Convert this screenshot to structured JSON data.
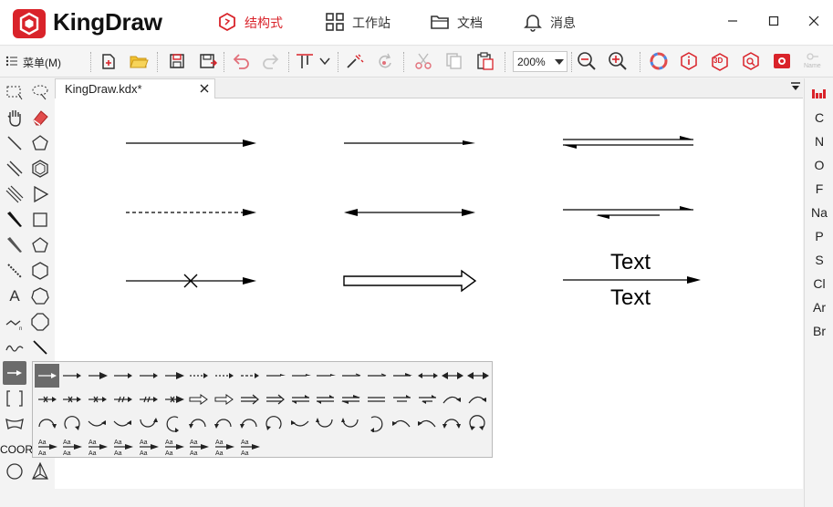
{
  "app": {
    "name": "KingDraw",
    "brand_color": "#d9232a"
  },
  "nav": {
    "tabs": [
      {
        "label": "结构式",
        "icon": "structure-icon",
        "active": true
      },
      {
        "label": "工作站",
        "icon": "workstation-icon",
        "active": false
      },
      {
        "label": "文档",
        "icon": "folder-icon",
        "active": false
      },
      {
        "label": "消息",
        "icon": "bell-icon",
        "active": false
      }
    ]
  },
  "window_controls": [
    "minimize-icon",
    "maximize-icon",
    "close-icon"
  ],
  "toolbar": {
    "menu_label": "菜单(M)",
    "zoom_value": "200%",
    "name_label": "Name",
    "badge_3d": "3D"
  },
  "document": {
    "tab_label": "KingDraw.kdx*"
  },
  "left_tools": {
    "text_tool_label": "A",
    "coord_label": "COOR"
  },
  "canvas": {
    "text_above": "Text",
    "text_below": "Text"
  },
  "elements": [
    "C",
    "N",
    "O",
    "F",
    "Na",
    "P",
    "S",
    "Cl",
    "Ar",
    "Br"
  ],
  "popup": {
    "aa_label": "Aa"
  }
}
